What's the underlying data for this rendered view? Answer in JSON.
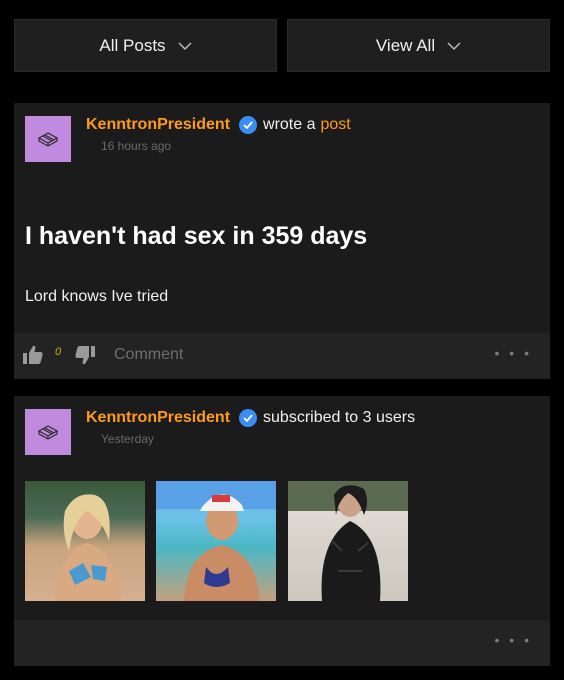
{
  "filters": {
    "left_label": "All Posts",
    "right_label": "View All"
  },
  "posts": [
    {
      "username": "KenntronPresident",
      "action": "wrote a",
      "action_link": "post",
      "time": "16 hours ago",
      "title": "I haven't had sex in 359 days",
      "body": "Lord knows Ive tried",
      "like_count": "0",
      "comment_label": "Comment",
      "more": "• • •"
    },
    {
      "username": "KenntronPresident",
      "action": "subscribed to 3 users",
      "time": "Yesterday",
      "more": "• • •",
      "photos": [
        "user-photo-1",
        "user-photo-2",
        "user-photo-3"
      ]
    }
  ],
  "colors": {
    "accent": "#ff9a1f",
    "verified": "#3b8cf5",
    "avatar_bg": "#c08bde",
    "card_bg": "#1b1b1b",
    "page_bg": "#000000"
  },
  "icons": {
    "chevron": "chevron-down-icon",
    "verified": "verified-check-icon",
    "like": "thumbs-up-icon",
    "dislike": "thumbs-down-icon",
    "avatar": "ingot-icon"
  }
}
